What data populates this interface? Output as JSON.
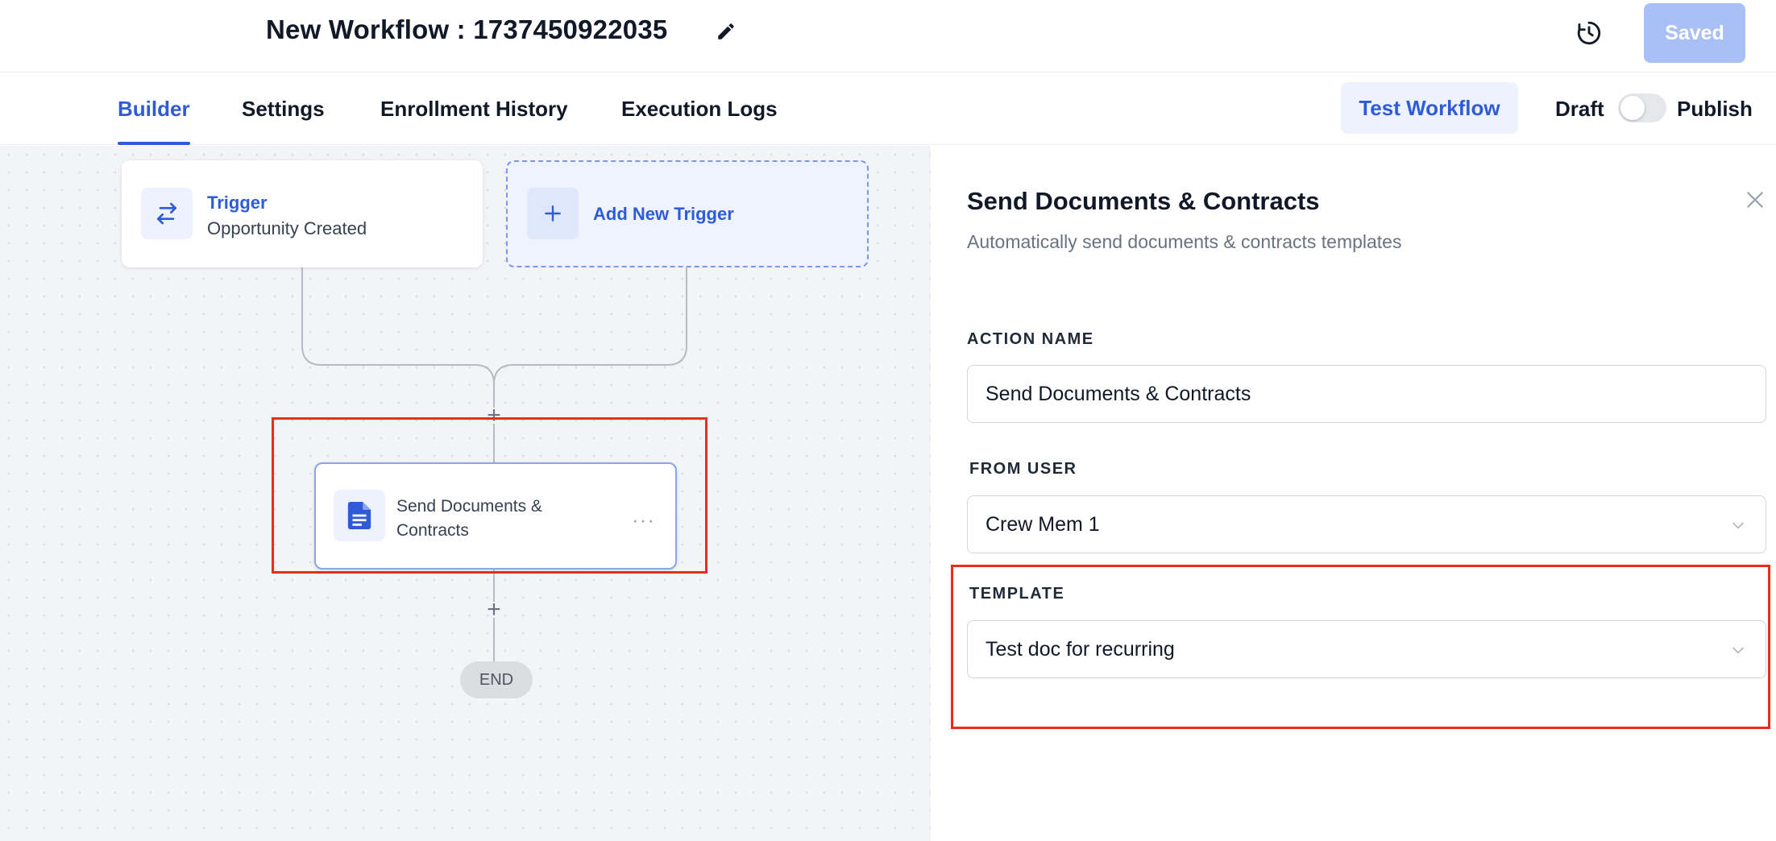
{
  "header": {
    "title": "New Workflow : 1737450922035",
    "saved_label": "Saved",
    "icons": {
      "edit": "pencil-icon",
      "history": "history-clock-icon"
    }
  },
  "tabs": {
    "items": [
      {
        "label": "Builder",
        "active": true
      },
      {
        "label": "Settings",
        "active": false
      },
      {
        "label": "Enrollment History",
        "active": false
      },
      {
        "label": "Execution Logs",
        "active": false
      }
    ],
    "test_workflow_label": "Test Workflow",
    "draft_label": "Draft",
    "publish_label": "Publish",
    "published": false
  },
  "canvas": {
    "trigger": {
      "title": "Trigger",
      "subtitle": "Opportunity Created",
      "icon": "swap-arrows-icon"
    },
    "add_trigger_label": "Add New Trigger",
    "action": {
      "label": "Send Documents & Contracts",
      "icon": "document-icon"
    },
    "add_step_symbol": "+",
    "more_symbol": "···",
    "end_label": "END"
  },
  "panel": {
    "title": "Send Documents & Contracts",
    "subtitle": "Automatically send documents & contracts templates",
    "action_name": {
      "label": "ACTION NAME",
      "value": "Send Documents & Contracts"
    },
    "from_user": {
      "label": "FROM USER",
      "value": "Crew Mem 1"
    },
    "template": {
      "label": "TEMPLATE",
      "value": "Test doc for recurring"
    }
  },
  "colors": {
    "accent": "#2f5bd8",
    "saved_button": "#a9c0f6",
    "highlight": "#ea2c1a",
    "canvas_bg": "#f3f4f7"
  }
}
